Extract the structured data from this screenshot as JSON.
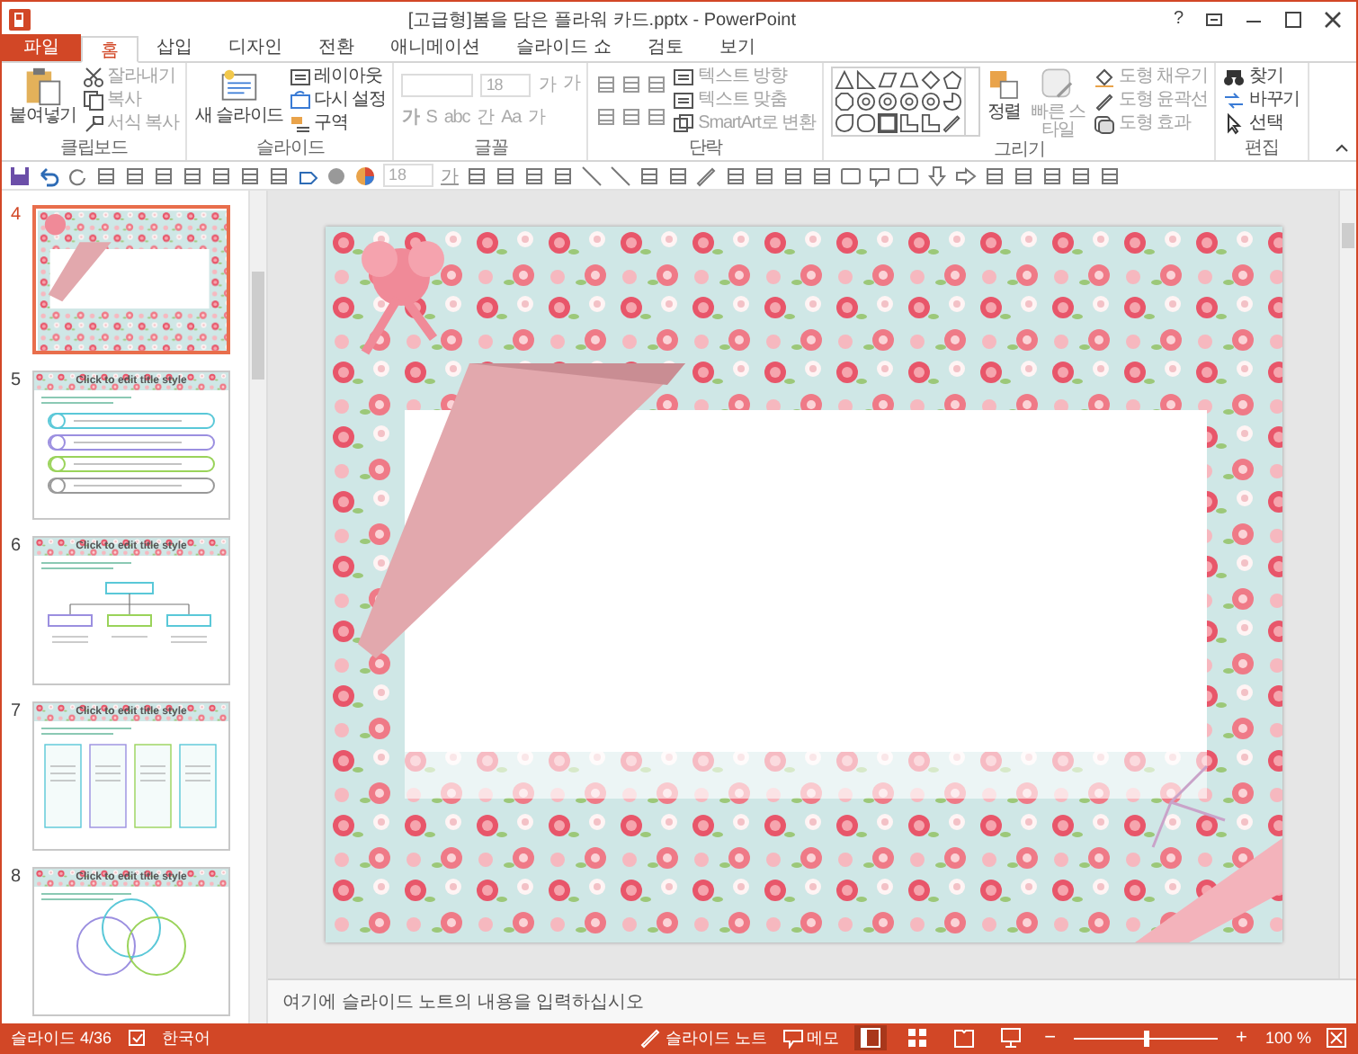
{
  "window": {
    "title": "[고급형]봄을 담은 플라워 카드.pptx - PowerPoint",
    "help": "?"
  },
  "tabs": [
    {
      "label": "파일",
      "kind": "file",
      "selected": false
    },
    {
      "label": "홈",
      "kind": "tab",
      "selected": true
    },
    {
      "label": "삽입",
      "kind": "tab",
      "selected": false
    },
    {
      "label": "디자인",
      "kind": "tab",
      "selected": false
    },
    {
      "label": "전환",
      "kind": "tab",
      "selected": false
    },
    {
      "label": "애니메이션",
      "kind": "tab",
      "selected": false
    },
    {
      "label": "슬라이드 쇼",
      "kind": "tab",
      "selected": false
    },
    {
      "label": "검토",
      "kind": "tab",
      "selected": false
    },
    {
      "label": "보기",
      "kind": "tab",
      "selected": false
    }
  ],
  "ribbon": [
    {
      "label": "클립보드",
      "large": {
        "label": "붙여넣기",
        "disabled": false
      },
      "items": [
        {
          "label": "잘라내기",
          "disabled": true
        },
        {
          "label": "복사",
          "disabled": true
        },
        {
          "label": "서식 복사",
          "disabled": true
        }
      ]
    },
    {
      "label": "슬라이드",
      "large": {
        "label": "새 슬라이드",
        "disabled": false
      },
      "items": [
        {
          "label": "레이아웃",
          "disabled": false
        },
        {
          "label": "다시 설정",
          "disabled": false
        },
        {
          "label": "구역",
          "disabled": false
        }
      ]
    },
    {
      "label": "글꼴",
      "font": {
        "size": "18",
        "glyphs": [
          "가",
          "가",
          "가",
          "S",
          "abc",
          "간",
          "Aa",
          "가"
        ]
      }
    },
    {
      "label": "단락",
      "items": [
        {
          "label": "텍스트 방향",
          "disabled": true
        },
        {
          "label": "텍스트 맞춤",
          "disabled": true
        },
        {
          "label": "SmartArt로 변환",
          "disabled": true
        }
      ]
    },
    {
      "label": "그리기",
      "arrange": {
        "label": "정렬",
        "disabled": false
      },
      "quick": {
        "label": "빠른 스타일",
        "disabled": true
      },
      "items": [
        {
          "label": "도형 채우기",
          "disabled": true
        },
        {
          "label": "도형 윤곽선",
          "disabled": true
        },
        {
          "label": "도형 효과",
          "disabled": true
        }
      ]
    },
    {
      "label": "편집",
      "items": [
        {
          "label": "찾기",
          "disabled": false
        },
        {
          "label": "바꾸기",
          "disabled": false
        },
        {
          "label": "선택",
          "disabled": false
        }
      ]
    }
  ],
  "qat": {
    "size": "18",
    "glyph": "가"
  },
  "slides": [
    {
      "number": "4",
      "kind": "card",
      "selected": true
    },
    {
      "number": "5",
      "kind": "list",
      "title": "Click to edit title style",
      "selected": false
    },
    {
      "number": "6",
      "kind": "org",
      "title": "Click to edit title style",
      "selected": false
    },
    {
      "number": "7",
      "kind": "columns",
      "title": "Click to edit title style",
      "selected": false
    },
    {
      "number": "8",
      "kind": "venn",
      "title": "Click to edit title style",
      "selected": false
    }
  ],
  "notes": {
    "placeholder": "여기에 슬라이드 노트의 내용을 입력하십시오"
  },
  "status_bar": {
    "slide": "슬라이드 4/36",
    "language": "한국어",
    "notes": "슬라이드 노트",
    "comments": "메모",
    "views": [
      {
        "kind": "normal",
        "selected": true
      },
      {
        "kind": "sorter",
        "selected": false
      },
      {
        "kind": "reading",
        "selected": false
      },
      {
        "kind": "show",
        "selected": false
      }
    ],
    "zoom": {
      "out": "−",
      "in": "+",
      "level": 0.5,
      "label": "100 %"
    }
  }
}
